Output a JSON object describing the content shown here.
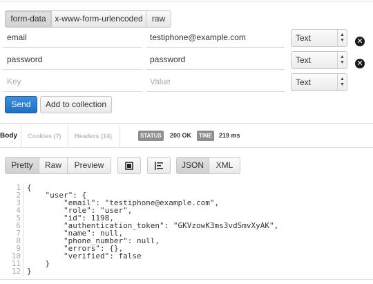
{
  "body_types": [
    "form-data",
    "x-www-form-urlencoded",
    "raw"
  ],
  "params": [
    {
      "key": "email",
      "value": "testiphone@example.com",
      "type": "Text",
      "removable": true
    },
    {
      "key": "password",
      "value": "password",
      "type": "Text",
      "removable": true
    }
  ],
  "new_param": {
    "key_placeholder": "Key",
    "value_placeholder": "Value",
    "type": "Text"
  },
  "actions": {
    "send": "Send",
    "add_to_collection": "Add to collection"
  },
  "response_tabs": {
    "body": "Body",
    "cookies": "Cookies (7)",
    "headers": "Headers (14)"
  },
  "status": {
    "label": "STATUS",
    "value": "200 OK"
  },
  "time": {
    "label": "TIME",
    "value": "219 ms"
  },
  "view_modes": {
    "pretty": "Pretty",
    "raw": "Raw",
    "preview": "Preview",
    "json": "JSON",
    "xml": "XML"
  },
  "response_lines": [
    "{",
    "    \"user\": {",
    "        \"email\": \"testiphone@example.com\",",
    "        \"role\": \"user\",",
    "        \"id\": 1198,",
    "        \"authentication_token\": \"GKVzowK3ms3vdSmvXyAK\",",
    "        \"name\": null,",
    "        \"phone_number\": null,",
    "        \"errors\": {},",
    "        \"verified\": false",
    "    }",
    "}"
  ],
  "icons": {
    "delete": "close-circle-icon",
    "fullscreen": "fullscreen-icon",
    "wrap": "wrap-lines-icon",
    "select_arrows": "up-down-arrows-icon"
  }
}
